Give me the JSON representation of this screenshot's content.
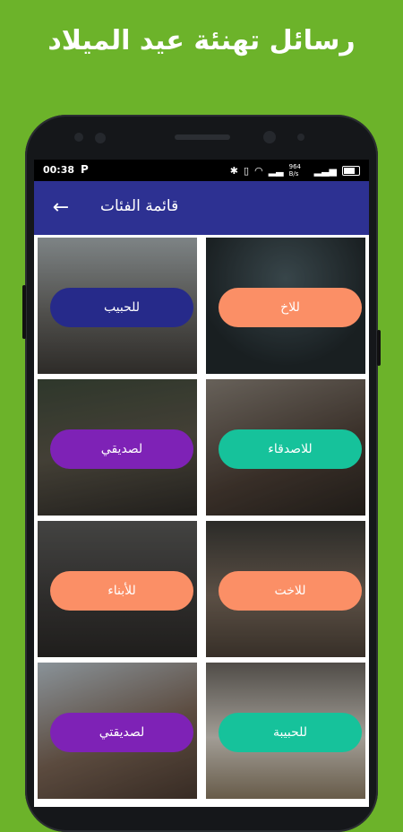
{
  "headline": "رسائل تهنئة عيد الميلاد",
  "status_bar": {
    "time": "00:38",
    "app_icon": "P",
    "speed": "964 B/s",
    "battery": "82"
  },
  "app_bar": {
    "title": "قائمة الفئات",
    "back_icon": "arrow-left-icon"
  },
  "categories": [
    {
      "label": "للاخ",
      "color": "#fb8f66"
    },
    {
      "label": "للحبيب",
      "color": "#262a8a"
    },
    {
      "label": "للاصدقاء",
      "color": "#16c29b"
    },
    {
      "label": "لصديقي",
      "color": "#7e22b6"
    },
    {
      "label": "للاخت",
      "color": "#fb8f66"
    },
    {
      "label": "للأبناء",
      "color": "#fb8f66"
    },
    {
      "label": "للحبيبة",
      "color": "#16c29b"
    },
    {
      "label": "لصديقتي",
      "color": "#7e22b6"
    }
  ]
}
